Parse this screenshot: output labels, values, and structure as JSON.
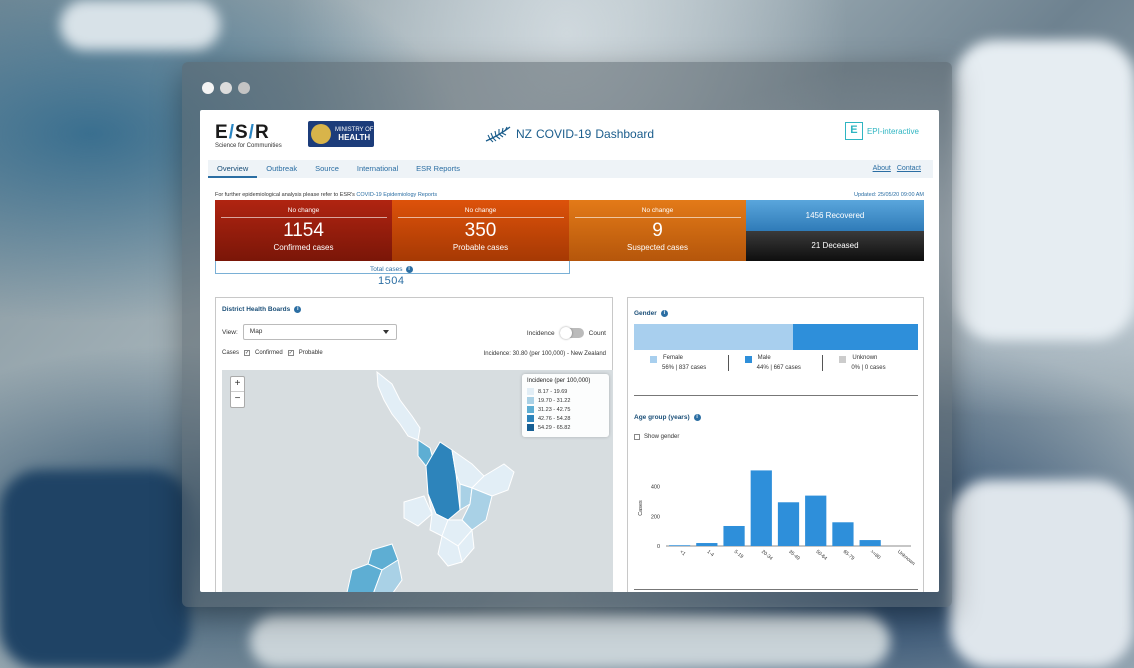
{
  "header": {
    "esr_sub": "Science for Communities",
    "moh_line1": "MINISTRY OF",
    "moh_line2": "HEALTH",
    "title_prefix": "NZ",
    "title_main": "COVID-19",
    "title_suffix": "Dashboard",
    "epi_text": "EPI-interactive"
  },
  "nav": {
    "items": [
      "Overview",
      "Outbreak",
      "Source",
      "International",
      "ESR Reports"
    ],
    "about": "About",
    "contact": "Contact"
  },
  "info": {
    "text": "For further epidemiological analysis please refer to ESR's",
    "link": "COVID-19 Epidemiology Reports",
    "updated": "Updated: 25/05/20 09:00 AM"
  },
  "stats": {
    "confirmed": {
      "change": "No change",
      "value": "1154",
      "label": "Confirmed cases"
    },
    "probable": {
      "change": "No change",
      "value": "350",
      "label": "Probable cases"
    },
    "suspected": {
      "change": "No change",
      "value": "9",
      "label": "Suspected cases"
    },
    "recovered": "1456 Recovered",
    "deceased": "21 Deceased",
    "total_label": "Total cases",
    "total_value": "1504"
  },
  "dhb": {
    "title": "District Health Boards",
    "view_label": "View:",
    "view_value": "Map",
    "toggle_left": "Incidence",
    "toggle_right": "Count",
    "cases_label": "Cases",
    "confirmed": "Confirmed",
    "probable": "Probable",
    "incidence_text": "Incidence: 30.80 (per 100,000) - New Zealand",
    "zoom_in": "+",
    "zoom_out": "−",
    "legend_title": "Incidence (per 100,000)",
    "legend": [
      {
        "label": "8.17 - 19.69",
        "color": "#e2eef6"
      },
      {
        "label": "19.70 - 31.22",
        "color": "#a9d1e6"
      },
      {
        "label": "31.23 - 42.75",
        "color": "#5eaed3"
      },
      {
        "label": "42.76 - 54.28",
        "color": "#2d84bb"
      },
      {
        "label": "54.29 - 65.82",
        "color": "#155e93"
      }
    ]
  },
  "gender": {
    "title": "Gender",
    "female": {
      "name": "Female",
      "value": "56% | 837 cases",
      "pct": 56,
      "color": "#a8cfee"
    },
    "male": {
      "name": "Male",
      "value": "44% | 667 cases",
      "pct": 44,
      "color": "#2e8fda"
    },
    "unknown": {
      "name": "Unknown",
      "value": "0% | 0 cases",
      "pct": 0,
      "color": "#cccccc"
    }
  },
  "age": {
    "title": "Age group (years)",
    "show_gender": "Show gender"
  },
  "chart_data": {
    "type": "bar",
    "categories": [
      "<1",
      "1-4",
      "5-19",
      "20-34",
      "35-49",
      "50-64",
      "65-79",
      ">=80",
      "Unknown"
    ],
    "values": [
      5,
      20,
      135,
      510,
      295,
      340,
      160,
      40,
      0
    ],
    "ylabel": "Cases",
    "yticks": [
      0,
      200,
      400
    ],
    "ylim": [
      0,
      560
    ],
    "color": "#2e8fda"
  }
}
